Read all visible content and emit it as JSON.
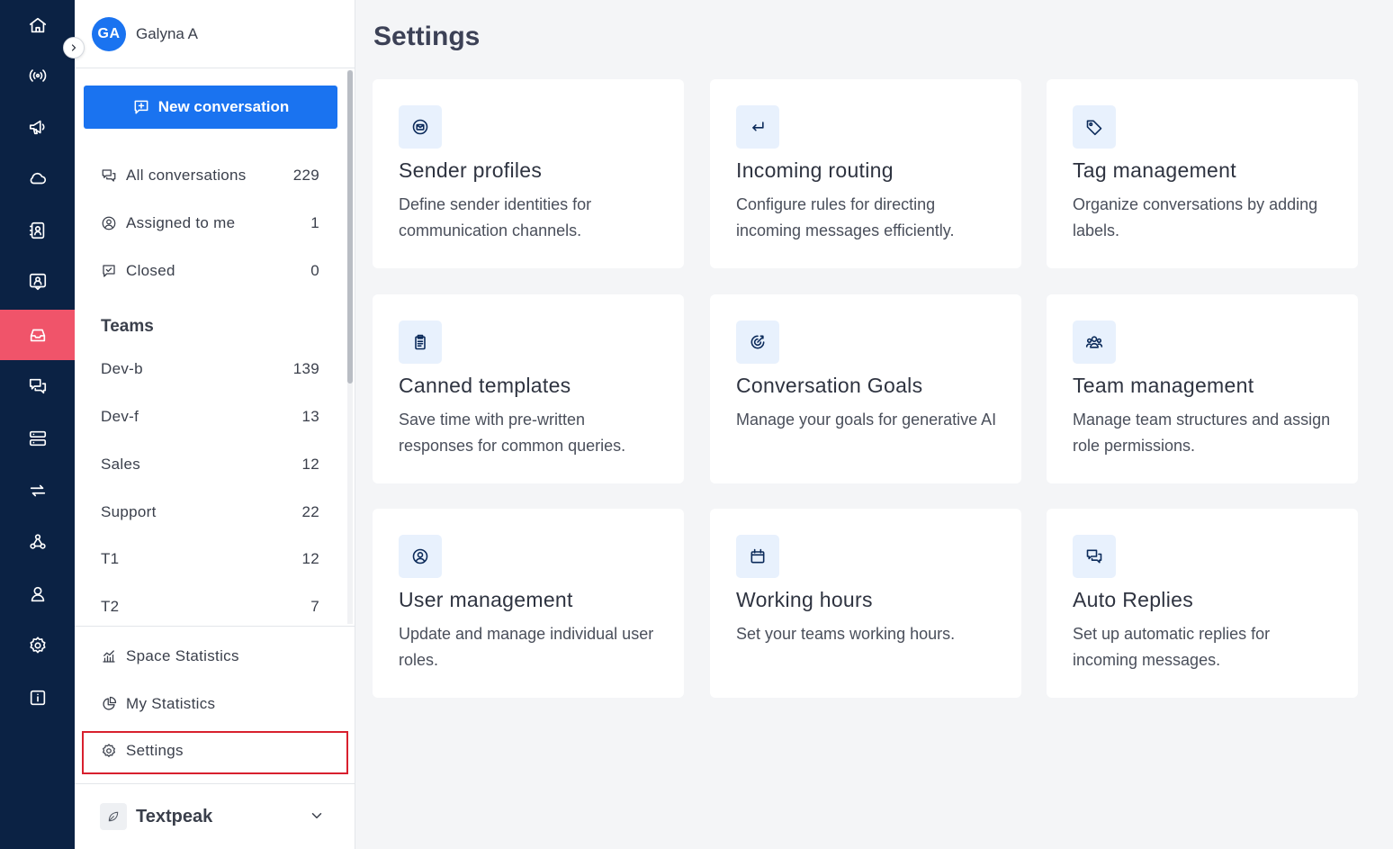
{
  "rail": [
    {
      "icon": "home-icon"
    },
    {
      "icon": "broadcast-icon"
    },
    {
      "icon": "megaphone-icon"
    },
    {
      "icon": "cloud-icon"
    },
    {
      "icon": "contacts-book-icon"
    },
    {
      "icon": "agent-chat-icon"
    },
    {
      "icon": "inbox-icon",
      "active": true
    },
    {
      "icon": "chat-bubbles-icon"
    },
    {
      "icon": "server-icon"
    },
    {
      "icon": "sync-arrows-icon"
    },
    {
      "icon": "webhook-icon"
    },
    {
      "icon": "user-icon"
    },
    {
      "icon": "gear-icon"
    },
    {
      "icon": "info-icon"
    }
  ],
  "user": {
    "initials": "GA",
    "name": "Galyna A"
  },
  "sidebar": {
    "new_conversation": "New conversation",
    "views": [
      {
        "label": "All conversations",
        "count": "229"
      },
      {
        "label": "Assigned to me",
        "count": "1"
      },
      {
        "label": "Closed",
        "count": "0"
      }
    ],
    "teams_title": "Teams",
    "teams": [
      {
        "label": "Dev-b",
        "count": "139"
      },
      {
        "label": "Dev-f",
        "count": "13"
      },
      {
        "label": "Sales",
        "count": "12"
      },
      {
        "label": "Support",
        "count": "22"
      },
      {
        "label": "T1",
        "count": "12"
      },
      {
        "label": "T2",
        "count": "7"
      }
    ],
    "bottom": [
      {
        "label": "Space Statistics"
      },
      {
        "label": "My Statistics"
      },
      {
        "label": "Settings"
      }
    ],
    "workspace": "Textpeak"
  },
  "main": {
    "title": "Settings",
    "cards": [
      {
        "title": "Sender profiles",
        "desc": "Define sender identities for communication channels.",
        "icon": "email-circle-icon"
      },
      {
        "title": "Incoming routing",
        "desc": "Configure rules for directing incoming messages efficiently.",
        "icon": "return-arrow-icon"
      },
      {
        "title": "Tag management",
        "desc": "Organize conversations by adding labels.",
        "icon": "tag-icon"
      },
      {
        "title": "Canned templates",
        "desc": "Save time with pre-written responses for common queries.",
        "icon": "clipboard-icon"
      },
      {
        "title": "Conversation Goals",
        "desc": "Manage your goals for generative AI",
        "icon": "target-icon"
      },
      {
        "title": "Team management",
        "desc": "Manage team structures and assign role permissions.",
        "icon": "team-icon"
      },
      {
        "title": "User management",
        "desc": "Update and manage individual user roles.",
        "icon": "user-circle-icon"
      },
      {
        "title": "Working hours",
        "desc": "Set your teams working hours.",
        "icon": "calendar-icon"
      },
      {
        "title": "Auto Replies",
        "desc": "Set up automatic replies for incoming messages.",
        "icon": "chat-bubbles-icon"
      }
    ]
  }
}
